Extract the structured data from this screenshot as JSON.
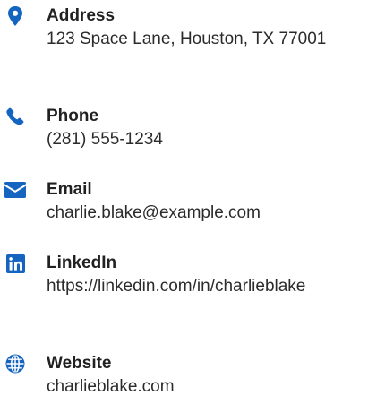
{
  "colors": {
    "accent": "#1565c0",
    "text": "#212121"
  },
  "contacts": [
    {
      "icon": "map-pin-icon",
      "label": "Address",
      "value": "123 Space Lane, Houston, TX 77001"
    },
    {
      "icon": "phone-icon",
      "label": "Phone",
      "value": "(281) 555-1234"
    },
    {
      "icon": "envelope-icon",
      "label": "Email",
      "value": "charlie.blake@example.com"
    },
    {
      "icon": "linkedin-icon",
      "label": "LinkedIn",
      "value": "https://linkedin.com/in/charlieblake"
    },
    {
      "icon": "globe-icon",
      "label": "Website",
      "value": "charlieblake.com"
    }
  ]
}
